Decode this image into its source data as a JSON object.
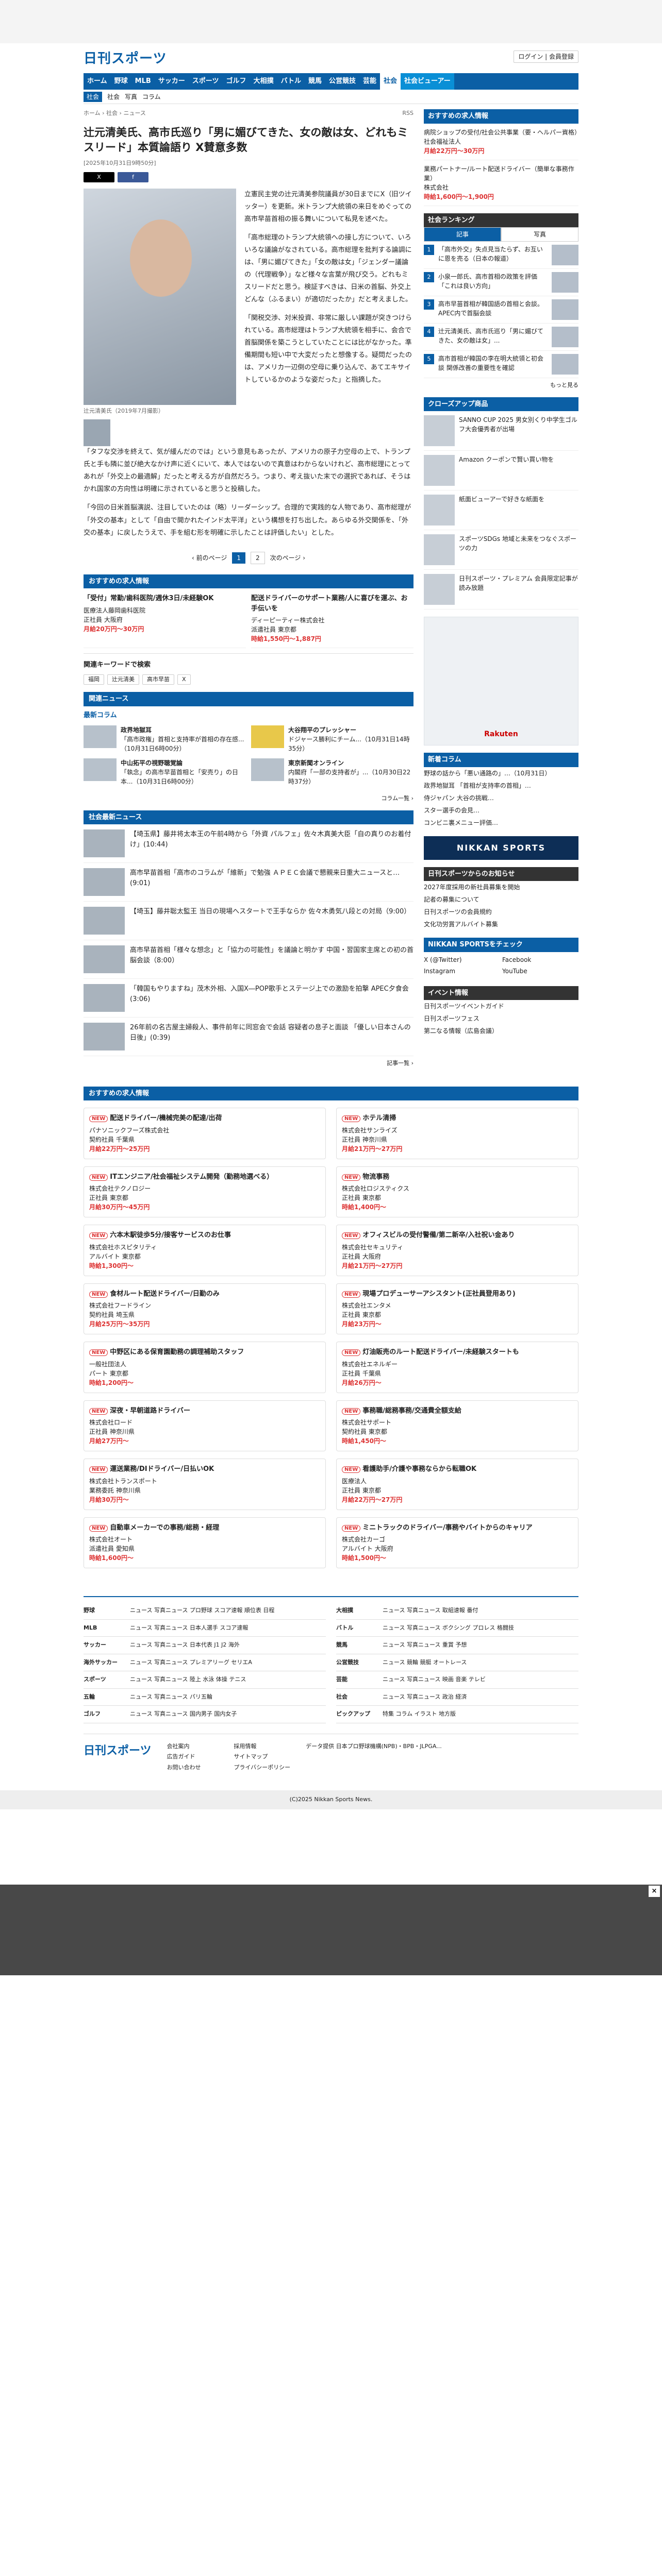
{
  "logo": "日刊スポーツ",
  "header": {
    "login": "ログイン | 会員登録"
  },
  "nav": [
    "ホーム",
    "野球",
    "MLB",
    "サッカー",
    "スポーツ",
    "ゴルフ",
    "大相撲",
    "バトル",
    "競馬",
    "公営競技",
    "芸能",
    "社会",
    "社会ビューアー"
  ],
  "subnav": {
    "badge": "社会",
    "items": [
      "社会",
      "写真",
      "コラム"
    ]
  },
  "crumb": "ホーム › 社会 › ニュース",
  "rss": "RSS",
  "article": {
    "title": "辻元清美氏、高市氏巡り「男に媚びてきた、女の敵は女、どれもミスリード」本質論語り X賛意多数",
    "date": "[2025年10月31日9時50分]",
    "caption": "辻元清美氏（2019年7月撮影）",
    "paras": [
      "立憲民主党の辻元清美参院議員が30日までにX（旧ツイッター）を更新。米トランプ大統領の来日をめぐっての高市早苗首相の振る舞いについて私見を述べた。",
      "「高市総理のトランプ大統領への接し方について、いろいろな議論がなされている。高市総理を批判する論調には、「男に媚びてきた」「女の敵は女」「ジェンダー議論の（代理戦争）」など様々な言葉が飛び交う。どれもミスリードだと思う。検証すべきは、日米の首脳、外交上どんな（ふるまい）が適切だったか」だと考えました。",
      "「関税交渉、対米投資、非常に厳しい課題が突きつけられている。高市総理はトランプ大統領を相手に、会合で首脳関係を築こうとしていたことには比がなかった。準備期間も短い中で大変だったと想像する。疑問だったのは、アメリカ一辺倒の空母に乗り込んで、あてエキサイトしているかのような姿だった」と指摘した。",
      "「タフな交渉を終えて、気が緩んだのでは」という意見もあったが、アメリカの原子力空母の上で、トランプ氏と手も隣に並び絶大なかけ声に近くにいて、本人ではないので真意はわからないけれど、高市総理にとってあれが「外交上の最適解」だったと考える方が自然だろう。つまり、考え抜いた末での選択であれば、そうはかれ国家の方向性は明確に示されていると思うと投稿した。",
      "「今回の日米首脳演説、注目していたのは（略）リーダーシップ。合理的で実践的な人物であり、高市総理が「外交の基本」として「自由で開かれたインド太平洋」という構想を打ち出した。あらゆる外交関係を、「外交の基本」に戻したうえで、手を組む形を明確に示したことは評価したい」とした。"
    ]
  },
  "pager": {
    "prev": "‹ 前のページ",
    "p1": "1",
    "p2": "2",
    "next": "次のページ ›"
  },
  "job_section": "おすすめの求人情報",
  "jobs_main": [
    {
      "t": "「受付」常勤/歯科医院/週休3日/未経験OK",
      "c": "医療法人藤岡歯科医院",
      "loc": "正社員 大阪府",
      "s": "月給20万円〜30万円"
    },
    {
      "t": "配送ドライバーのサポート業務/人に喜びを運ぶ、お手伝いを",
      "c": "ディーピーティー株式会社",
      "loc": "派遣社員 東京都",
      "s": "時給1,550円〜1,887円"
    }
  ],
  "kw_title": "関連キーワードで検索",
  "keywords": [
    "福岡",
    "辻元清美",
    "高市早苗",
    "X"
  ],
  "latest_title": "関連ニュース",
  "latest_h": "最新コラム",
  "news_cards": [
    {
      "t": "政界地獄耳",
      "d": "「高市政権」首相と支持率が首相の存在感...（10月31日6時00分）"
    },
    {
      "t": "大谷翔平のプレッシャー",
      "d": "ドジャース勝利にチーム...（10月31日14時35分）"
    },
    {
      "t": "中山拓平の視野聴覚論",
      "d": "「執念」の高市早苗首相と「安売り」の日本...（10月31日6時00分）"
    },
    {
      "t": "東京新聞オンライン",
      "d": "内閣府「一部の支持者が」...（10月30日22時37分）"
    }
  ],
  "social_title": "社会最新ニュース",
  "social_news": [
    "【埼玉県】藤井将太本王の午前4時から「外資 パルフェ」佐々木真美大臣「自の真りのお着付け」(10:44)",
    "高市早苗首相「高市のコラムが「維新」で勉強 ＡＰＥＣ会議で懇親来日重大ニュースと…(9:01)",
    "【埼玉】藤井聡太監王 当日の現場へスタートで王手ならか 佐々木勇気八段との対局（9:00）",
    "高市早苗首相「様々な想念」と「協力の可能性」を議論と明かす 中国・習国家主席との初の首脳会談（8:00）",
    "「韓国もやりますね」茂木外相、入国X―POP歌手とステージ上での激励を拍撃 APEC夕食会(3:06)",
    "26年前の名古屋主婦殺人、事件前年に同窓会で会話 容疑者の息子と面談 「優しい日本さんの日後」(0:39)"
  ],
  "side": {
    "jobs_h": "おすすめの求人情報",
    "jobs": [
      {
        "t": "病院ショップの受付/社会公共事業（要・ヘルパー資格）",
        "c": "社会福祉法人",
        "s": "月給22万円〜30万円"
      },
      {
        "t": "業務パートナー/ルート配送ドライバー（簡単な事務作業）",
        "c": "株式会社",
        "s": "時給1,600円〜1,900円"
      }
    ],
    "rank_h": "社会ランキング",
    "tabs": [
      "記事",
      "写真"
    ],
    "ranks": [
      "「高市外交」失点見当たらず、お互いに恩を売る（日本の報道）",
      "小泉一郎氏、高市首相の政策を評価「これは良い方向」",
      "高市早苗首相が韓国語の首相と会談。APEC内で首脳会談",
      "辻元清美氏、高市氏巡り「男に媚びてきた、女の敵は女」...",
      "高市首相が韓国の李在明大統領と初会談 関係改善の重要性を確認"
    ],
    "more": "もっと見る",
    "pr_h": "クローズアップ商品",
    "prs": [
      "SANNO CUP 2025 男女別くり中学生ゴルフ大会優秀者が出場",
      "Amazon クーポンで賢い買い物を",
      "紙面ビューアーで好きな紙面を",
      "スポーツSDGs 地域と未来をつなぐスポーツの力",
      "日刊スポーツ・プレミアム 会員限定記事が読み放題"
    ],
    "ad": "Rakuten",
    "latest_h": "新着コラム",
    "latest": [
      "野球の話から「悪い通路の」…（10月31日）",
      "政界地獄耳 「首相が支持率の首相」…",
      "侍ジャパン 大谷の挑戦…",
      "スター選手の会見…",
      "コンビニ裏メニュー評価…"
    ],
    "banner": "NIKKAN SPORTS",
    "links_h": "日刊スポーツからのお知らせ",
    "links": [
      "2027年度採用の新社員募集を開始",
      "記者の募集について",
      "日刊スポーツの会員規約",
      "文化功労賞アルバイト募集"
    ],
    "sns_h": "NIKKAN SPORTSをチェック",
    "sns": [
      "X (@Twitter)",
      "Facebook",
      "Instagram",
      "YouTube"
    ],
    "event_h": "イベント情報",
    "events": [
      "日刊スポーツイベントガイド",
      "日刊スポーツフェス",
      "第二なる情報（広島会議）"
    ]
  },
  "job_bottom_h": "おすすめの求人情報",
  "job_cards": [
    {
      "t": "配送ドライバー/機械完美の配達/出荷",
      "c": "パナソニックフーズ株式会社",
      "l": "契約社員 千葉県",
      "s": "月給22万円〜25万円"
    },
    {
      "t": "ホテル清掃",
      "c": "株式会社サンライズ",
      "l": "正社員 神奈川県",
      "s": "月給21万円〜27万円"
    },
    {
      "t": "ITエンジニア/社会福祉システム開発（勤務地選べる）",
      "c": "株式会社テクノロジー",
      "l": "正社員 東京都",
      "s": "月給30万円〜45万円"
    },
    {
      "t": "物流事務",
      "c": "株式会社ロジスティクス",
      "l": "正社員 東京都",
      "s": "時給1,400円〜"
    },
    {
      "t": "六本木駅徒歩5分/接客サービスのお仕事",
      "c": "株式会社ホスピタリティ",
      "l": "アルバイト 東京都",
      "s": "時給1,300円〜"
    },
    {
      "t": "オフィスビルの受付警備/第二新卒/入社祝い金あり",
      "c": "株式会社セキュリティ",
      "l": "正社員 大阪府",
      "s": "月給21万円〜27万円"
    },
    {
      "t": "食材ルート配送ドライバー/日勤のみ",
      "c": "株式会社フードライン",
      "l": "契約社員 埼玉県",
      "s": "月給25万円〜35万円"
    },
    {
      "t": "現場プロデューサーアシスタント(正社員登用あり)",
      "c": "株式会社エンタメ",
      "l": "正社員 東京都",
      "s": "月給23万円〜"
    },
    {
      "t": "中野区にある保育園勤務の調理補助スタッフ",
      "c": "一般社団法人",
      "l": "パート 東京都",
      "s": "時給1,200円〜"
    },
    {
      "t": "灯油販売のルート配送ドライバー/未経験スタートも",
      "c": "株式会社エネルギー",
      "l": "正社員 千葉県",
      "s": "月給26万円〜"
    },
    {
      "t": "深夜・早朝道路ドライバー",
      "c": "株式会社ロード",
      "l": "正社員 神奈川県",
      "s": "月給27万円〜"
    },
    {
      "t": "事務職/総務事務/交通費全額支給",
      "c": "株式会社サポート",
      "l": "契約社員 東京都",
      "s": "時給1,450円〜"
    },
    {
      "t": "運送業務/DIドライバー/日払いOK",
      "c": "株式会社トランスポート",
      "l": "業務委託 神奈川県",
      "s": "月給30万円〜"
    },
    {
      "t": "看護助手/介護や事務ならから転職OK",
      "c": "医療法人",
      "l": "正社員 東京都",
      "s": "月給22万円〜27万円"
    },
    {
      "t": "自動車メーカーでの事務/総務・経理",
      "c": "株式会社オート",
      "l": "派遣社員 愛知県",
      "s": "時給1,600円〜"
    },
    {
      "t": "ミニトラックのドライバー/事務やバイトからのキャリア",
      "c": "株式会社カーゴ",
      "l": "アルバイト 大阪府",
      "s": "時給1,500円〜"
    }
  ],
  "footer": [
    [
      "野球",
      "ニュース 写真ニュース プロ野球 スコア速報 順位表 日程"
    ],
    [
      "大相撲",
      "ニュース 写真ニュース 取組速報 番付"
    ],
    [
      "MLB",
      "ニュース 写真ニュース 日本人選手 スコア速報"
    ],
    [
      "バトル",
      "ニュース 写真ニュース ボクシング プロレス 格闘技"
    ],
    [
      "サッカー",
      "ニュース 写真ニュース 日本代表 J1 J2 海外"
    ],
    [
      "競馬",
      "ニュース 写真ニュース 重賞 予想"
    ],
    [
      "海外サッカー",
      "ニュース 写真ニュース プレミアリーグ セリエA"
    ],
    [
      "公営競技",
      "ニュース 競輪 競艇 オートレース"
    ],
    [
      "スポーツ",
      "ニュース 写真ニュース 陸上 水泳 体操 テニス"
    ],
    [
      "芸能",
      "ニュース 写真ニュース 映画 音楽 テレビ"
    ],
    [
      "五輪",
      "ニュース 写真ニュース パリ五輪"
    ],
    [
      "社会",
      "ニュース 写真ニュース 政治 経済"
    ],
    [
      "ゴルフ",
      "ニュース 写真ニュース 国内男子 国内女子"
    ],
    [
      "ピックアップ",
      "特集 コラム イラスト 地方版"
    ]
  ],
  "foot_links": [
    "会社案内",
    "採用情報",
    "広告ガイド",
    "サイトマップ",
    "お問い合わせ",
    "プライバシーポリシー"
  ],
  "foot_data": "データ提供 日本プロ野球機構(NPB)・BPB・JLPGA...",
  "copyright": "(C)2025 Nikkan Sports News."
}
